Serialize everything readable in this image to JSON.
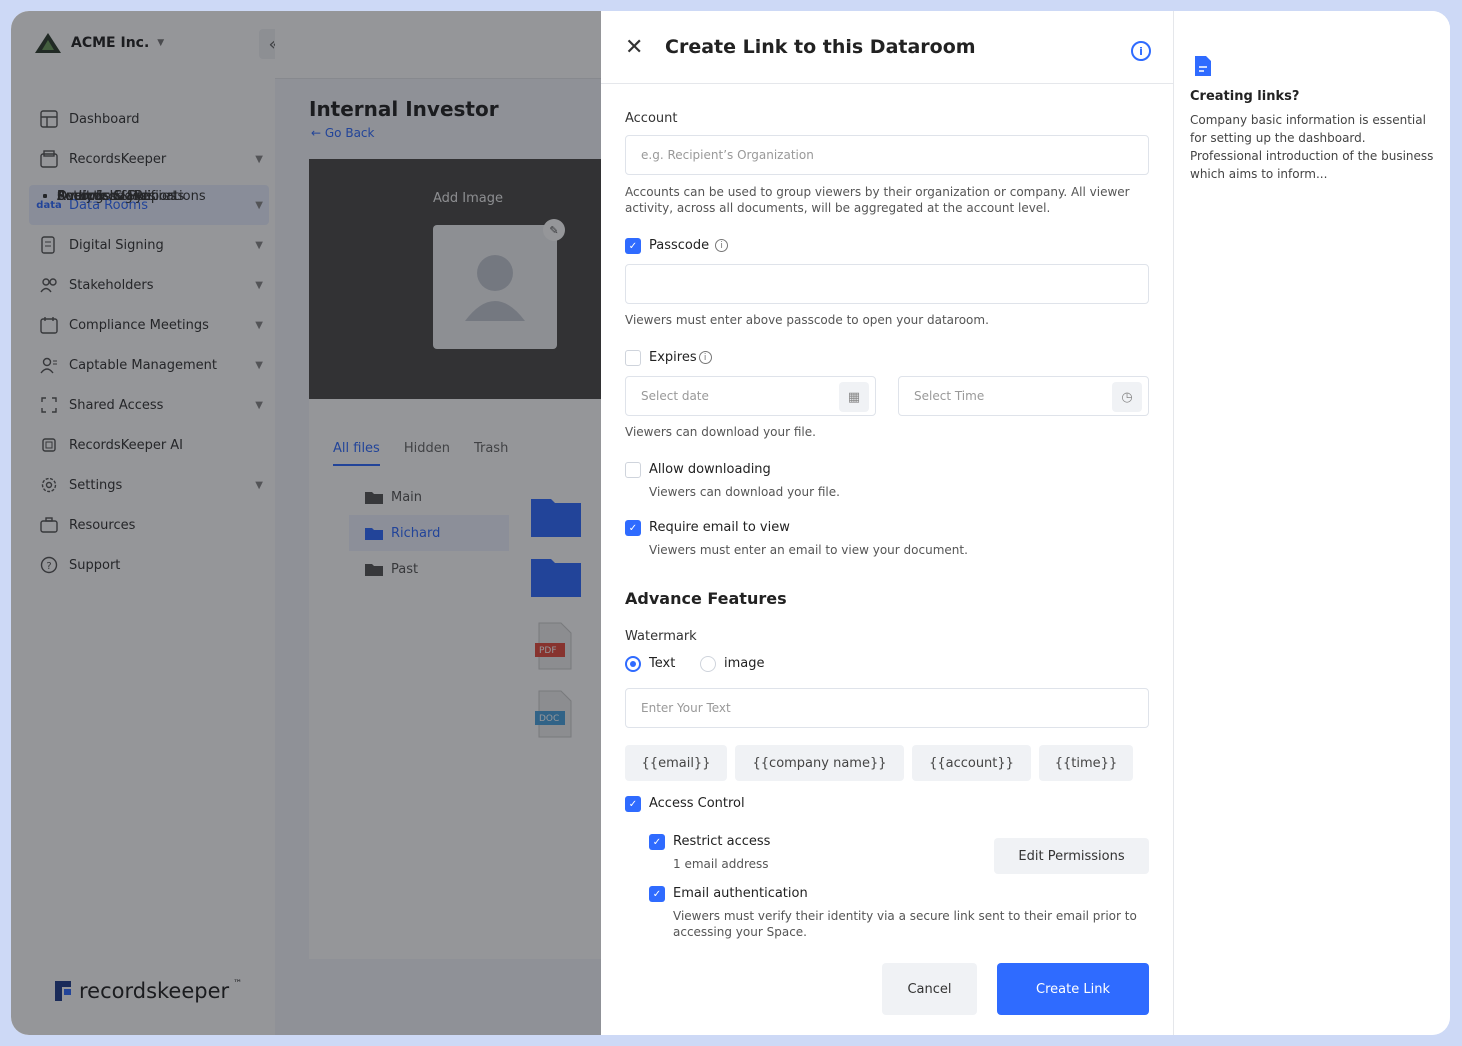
{
  "sidebar": {
    "company": "ACME Inc.",
    "collapse_icon": "double-chevron-left-icon",
    "nav": [
      {
        "label": "Dashboard",
        "icon": "dashboard-icon"
      },
      {
        "label": "RecordsKeeper",
        "icon": "records-icon"
      }
    ],
    "subitems": [
      "Overview",
      "Records & Files",
      "Sources & Sync",
      "Records Classifications",
      "Analytics & Reports",
      "Settings & Policies",
      "Audit & Logs"
    ],
    "nav2": [
      {
        "label": "Data Rooms",
        "icon": "data-icon"
      },
      {
        "label": "Digital Signing",
        "icon": "signing-icon"
      },
      {
        "label": "Stakeholders",
        "icon": "stakeholders-icon"
      },
      {
        "label": "Compliance Meetings",
        "icon": "meetings-icon"
      },
      {
        "label": "Captable Management",
        "icon": "captable-icon"
      },
      {
        "label": "Shared Access",
        "icon": "shared-icon"
      },
      {
        "label": "RecordsKeeper AI",
        "icon": "ai-icon"
      },
      {
        "label": "Settings",
        "icon": "settings-icon"
      },
      {
        "label": "Resources",
        "icon": "resources-icon"
      },
      {
        "label": "Support",
        "icon": "support-icon"
      }
    ],
    "logo_text": "recordskeeper",
    "logo_tm": "™"
  },
  "main": {
    "title": "Internal Investor",
    "go_back": "Go Back",
    "add_image": "Add Image",
    "tabs": [
      "All files",
      "Hidden",
      "Trash"
    ],
    "folders": [
      "Main",
      "Richard",
      "Past"
    ],
    "file_badges": [
      "PDF",
      "DOC"
    ]
  },
  "modal": {
    "title": "Create Link to this Dataroom",
    "account_label": "Account",
    "account_placeholder": "e.g. Recipient’s Organization",
    "account_help": "Accounts can be used to group viewers by their organization or company. All viewer activity, across all documents, will be aggregated at the account level.",
    "passcode_label": "Passcode",
    "passcode_help": "Viewers must enter above passcode to open your dataroom.",
    "expires_label": "Expires",
    "date_placeholder": "Select date",
    "time_placeholder": "Select Time",
    "expires_help": "Viewers can download your file.",
    "allow_download_label": "Allow downloading",
    "allow_download_help": "Viewers can download your file.",
    "require_email_label": "Require email to view",
    "require_email_help": "Viewers must enter an email to view your document.",
    "advance_title": "Advance Features",
    "watermark_label": "Watermark",
    "radio_text": "Text",
    "radio_image": "image",
    "watermark_placeholder": "Enter Your Text",
    "chips": [
      "{{email}}",
      "{{company name}}",
      "{{account}}",
      "{{time}}"
    ],
    "access_control_label": "Access Control",
    "restrict_label": "Restrict access",
    "restrict_help": "1 email address",
    "edit_permissions": "Edit Permissions",
    "email_auth_label": "Email authentication",
    "email_auth_help": "Viewers must verify their identity via a secure link sent to their email prior to accessing your Space.",
    "cancel": "Cancel",
    "create": "Create Link"
  },
  "help_panel": {
    "title": "Creating links?",
    "body": "Company basic information is essential for setting up the dashboard. Professional introduction of the business which aims to inform..."
  },
  "colors": {
    "accent": "#2f6bff",
    "overlay": "rgba(20,22,28,0.45)",
    "frame": "#cdd9f6"
  }
}
